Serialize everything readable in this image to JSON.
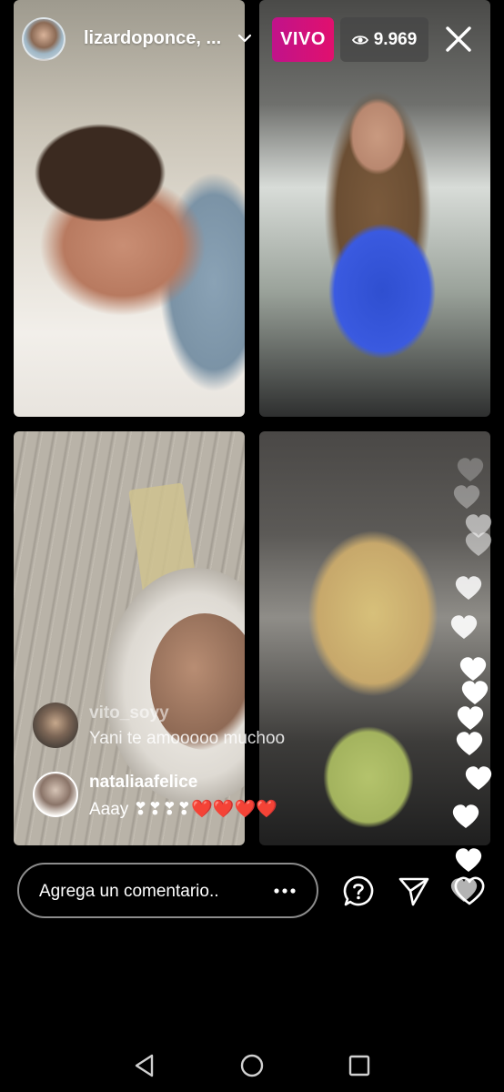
{
  "header": {
    "host_name": "lizardoponce, ...",
    "live_label": "VIVO",
    "viewer_count": "9.969"
  },
  "comments": [
    {
      "user": "vito_soyy",
      "text": "Yani te amooooo muchoo"
    },
    {
      "user": "nataliaafelice",
      "text": "Aaay ❣❣❣❣❤️❤️❤️❤️"
    }
  ],
  "composer": {
    "placeholder": "Agrega un comentario.."
  },
  "icons": {
    "close": "close-icon",
    "question": "question-icon",
    "send": "send-icon",
    "like": "heart-icon",
    "more": "more-icon"
  },
  "colors": {
    "live_badge": "#e1106e",
    "viewer_badge": "#464646"
  }
}
